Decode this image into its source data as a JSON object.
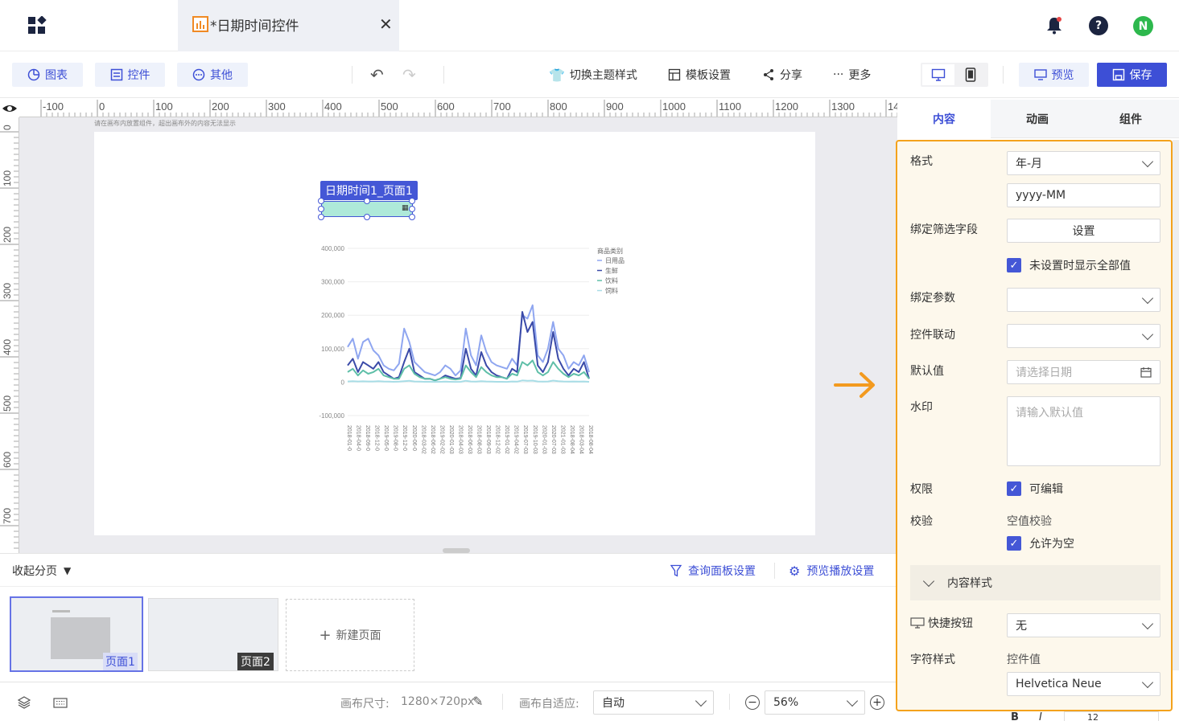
{
  "app": {
    "tab_title": "*日期时间控件",
    "notification_icon": "bell-icon",
    "help_icon": "help-icon",
    "avatar_initial": "N",
    "avatar_color": "#2db84d"
  },
  "toolbar": {
    "chart_label": "图表",
    "control_label": "控件",
    "other_label": "其他",
    "theme_label": "切换主题样式",
    "template_label": "模板设置",
    "share_label": "分享",
    "more_label": "更多",
    "preview_label": "预览",
    "save_label": "保存",
    "accent": "#3d4fd6"
  },
  "ruler": {
    "h_ticks": [
      "-100",
      "0",
      "100",
      "200",
      "300",
      "400",
      "500",
      "600",
      "700",
      "800",
      "900",
      "1000",
      "1100",
      "1200",
      "1300",
      "14"
    ],
    "v_ticks": [
      "0",
      "100",
      "200",
      "300",
      "400",
      "500",
      "600",
      "700"
    ]
  },
  "canvas": {
    "hint": "请在画布内放置组件，超出画布外的内容无法显示",
    "widget_label": "日期时间1_页面1"
  },
  "chart_data": {
    "type": "line",
    "legend_title": "商品类别",
    "legend_position": "top-right",
    "series": [
      {
        "name": "日用品",
        "color": "#8fa6f0",
        "values": [
          105000,
          130000,
          70000,
          120000,
          130000,
          95000,
          80000,
          50000,
          40000,
          35000,
          55000,
          160000,
          120000,
          60000,
          45000,
          30000,
          25000,
          20000,
          30000,
          50000,
          40000,
          20000,
          35000,
          160000,
          80000,
          50000,
          140000,
          90000,
          60000,
          50000,
          45000,
          40000,
          70000,
          50000,
          200000,
          190000,
          230000,
          80000,
          60000,
          100000,
          180000,
          100000,
          80000,
          40000,
          60000,
          50000,
          80000,
          30000
        ]
      },
      {
        "name": "生鲜",
        "color": "#3a4aa8",
        "values": [
          50000,
          70000,
          30000,
          60000,
          50000,
          40000,
          60000,
          30000,
          20000,
          10000,
          15000,
          60000,
          100000,
          30000,
          20000,
          10000,
          10000,
          5000,
          10000,
          20000,
          15000,
          10000,
          12000,
          100000,
          40000,
          20000,
          90000,
          50000,
          30000,
          20000,
          15000,
          10000,
          40000,
          30000,
          210000,
          150000,
          180000,
          50000,
          30000,
          60000,
          150000,
          70000,
          40000,
          20000,
          40000,
          30000,
          60000,
          10000
        ]
      },
      {
        "name": "饮料",
        "color": "#5fbfa8",
        "values": [
          30000,
          40000,
          20000,
          35000,
          25000,
          30000,
          40000,
          20000,
          15000,
          10000,
          10000,
          40000,
          50000,
          25000,
          15000,
          10000,
          10000,
          5000,
          10000,
          15000,
          10000,
          8000,
          10000,
          50000,
          30000,
          15000,
          45000,
          30000,
          20000,
          15000,
          15000,
          10000,
          25000,
          20000,
          60000,
          50000,
          65000,
          30000,
          20000,
          30000,
          60000,
          40000,
          25000,
          15000,
          25000,
          20000,
          30000,
          10000
        ]
      },
      {
        "name": "饲料",
        "color": "#a8dde6",
        "values": [
          2000,
          3000,
          2000,
          2500,
          2000,
          2000,
          3000,
          2000,
          1500,
          1000,
          1500,
          3000,
          4000,
          2000,
          1500,
          1000,
          1000,
          800,
          1000,
          1500,
          1000,
          800,
          1000,
          4000,
          2000,
          1500,
          3000,
          2000,
          1500,
          1000,
          1000,
          800,
          2000,
          1500,
          5000,
          4000,
          4500,
          2000,
          1500,
          2000,
          4500,
          3000,
          2000,
          1500,
          2000,
          1500,
          2000,
          1000
        ]
      }
    ],
    "y_ticks": [
      "400,000",
      "300,000",
      "200,000",
      "100,000",
      "0",
      "-100,000"
    ],
    "ylim": [
      -100000,
      400000
    ],
    "x_ticks": [
      "2018-01-0",
      "2018-04-0",
      "2018-09-0",
      "2018-12-0",
      "2019-05-0",
      "2019-08-0",
      "2019-12-0",
      "2020-06-0",
      "2018-03-02",
      "2018-06-02",
      "2019-02-02",
      "2020-01-03",
      "2018-04-03",
      "2018-06-03",
      "2018-08-03",
      "2018-09-03",
      "2018-12-02",
      "2019-01-02",
      "2019-04-02",
      "2019-07-03",
      "2019-10-03",
      "2020-01-03",
      "2020-07-03",
      "2021-01-03",
      "2018-08-04",
      "2018-03-04",
      "2018-08-04"
    ]
  },
  "pages": {
    "collapse_label": "收起分页",
    "query_panel_label": "查询面板设置",
    "playback_label": "预览播放设置",
    "page1_label": "页面1",
    "page2_label": "页面2",
    "new_page_label": "新建页面"
  },
  "bottom": {
    "canvas_size_label": "画布尺寸:",
    "canvas_size_value": "1280×720px",
    "adapt_label": "画布自适应:",
    "adapt_value": "自动",
    "zoom_value": "56%"
  },
  "panel": {
    "tabs": [
      "内容",
      "动画",
      "组件"
    ],
    "format_label": "格式",
    "format_value": "年-月",
    "format_pattern": "yyyy-MM",
    "bind_field_label": "绑定筛选字段",
    "bind_field_btn": "设置",
    "show_all_label": "未设置时显示全部值",
    "bind_param_label": "绑定参数",
    "link_label": "控件联动",
    "default_label": "默认值",
    "default_placeholder": "请选择日期",
    "watermark_label": "水印",
    "watermark_placeholder": "请输入默认值",
    "permission_label": "权限",
    "editable_label": "可编辑",
    "validation_label": "校验",
    "empty_check_label": "空值校验",
    "allow_empty_label": "允许为空",
    "content_style_label": "内容样式",
    "shortcut_label": "快捷按钮",
    "shortcut_value": "无",
    "char_style_label": "字符样式",
    "control_value_label": "控件值",
    "font_value": "Helvetica Neue",
    "font_size_value": "12",
    "highlight_color": "#f4a21c"
  }
}
